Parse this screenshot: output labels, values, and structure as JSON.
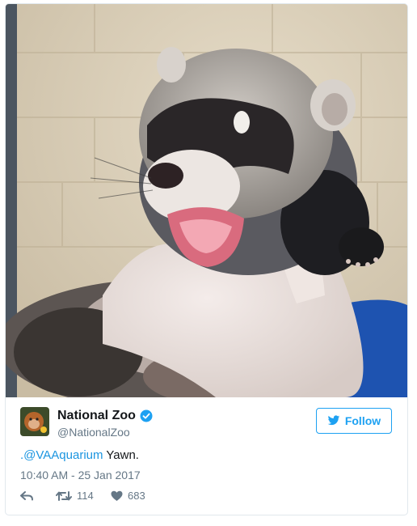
{
  "tweet": {
    "display_name": "National Zoo",
    "handle": "@NationalZoo",
    "follow_label": "Follow",
    "text_prefix": ".",
    "mention": "@VAAquarium",
    "text_body": " Yawn.",
    "timestamp": "10:40 AM - 25 Jan 2017",
    "retweet_count": "114",
    "like_count": "683"
  },
  "icons": {
    "verified": "verified-badge-icon",
    "follow": "twitter-bird-icon",
    "reply": "reply-icon",
    "retweet": "retweet-icon",
    "like": "heart-icon"
  },
  "colors": {
    "brand_blue": "#1da1f2",
    "link_blue": "#1b95e0",
    "secondary_text": "#657786",
    "border": "#e1e8ed"
  }
}
